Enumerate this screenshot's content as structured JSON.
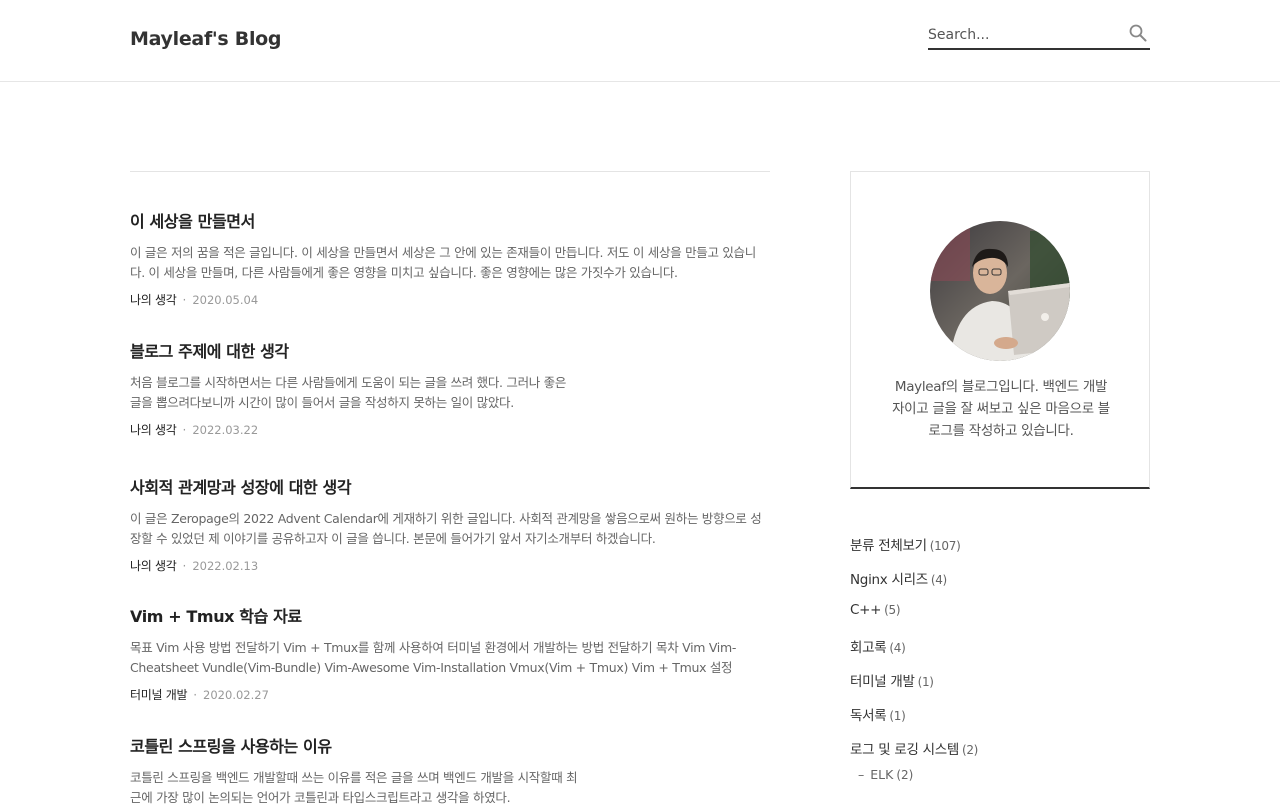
{
  "header": {
    "blog_title": "Mayleaf's Blog",
    "search_placeholder": "Search..."
  },
  "posts": [
    {
      "title": "이 세상을 만들면서",
      "excerpt": "이 글은 저의 꿈을 적은 글입니다. 이 세상을 만들면서 세상은 그 안에 있는 존재들이 만듭니다. 저도 이 세상을 만들고 있습니다. 이 세상을 만들며, 다른 사람들에게 좋은 영향을 미치고 싶습니다. 좋은 영향에는 많은 가짓수가 있습니다.",
      "category": "나의 생각",
      "date": "2020.05.04"
    },
    {
      "title": "블로그 주제에 대한 생각",
      "excerpt": "처음 블로그를 시작하면서는 다른 사람들에게 도움이 되는 글을 쓰려 했다. 그러나 좋은 글을 뽑으려다보니까 시간이 많이 들어서 글을 작성하지 못하는 일이 많았다.",
      "category": "나의 생각",
      "date": "2022.03.22"
    },
    {
      "title": "사회적 관계망과 성장에 대한 생각",
      "excerpt": "이 글은 Zeropage의 2022 Advent Calendar에 게재하기 위한 글입니다. 사회적 관계망을 쌓음으로써 원하는 방향으로 성장할 수 있었던 제 이야기를 공유하고자 이 글을 씁니다. 본문에 들어가기 앞서 자기소개부터 하겠습니다.",
      "category": "나의 생각",
      "date": "2022.02.13"
    },
    {
      "title": "Vim + Tmux 학습 자료",
      "excerpt": "목표 Vim 사용 방법 전달하기 Vim + Tmux를 함께 사용하여 터미널 환경에서 개발하는 방법 전달하기 목차 Vim Vim-Cheatsheet Vundle(Vim-Bundle) Vim-Awesome Vim-Installation Vmux(Vim + Tmux) Vim + Tmux 설정",
      "category": "터미널 개발",
      "date": "2020.02.27"
    },
    {
      "title": "코틀린 스프링을 사용하는 이유",
      "excerpt": "코틀린 스프링을 백엔드 개발할때 쓰는 이유를 적은 글을 쓰며 백엔드 개발을 시작할때 최근에 가장 많이 논의되는 언어가 코틀린과 타입스크립트라고 생각을 하였다.",
      "category": "",
      "date": ""
    }
  ],
  "sidebar": {
    "profile_description": "Mayleaf의 블로그입니다. 백엔드 개발자이고 글을 잘 써보고 싶은 마음으로 블로그를 작성하고 있습니다.",
    "categories": [
      {
        "label": "분류 전체보기",
        "count": "(107)"
      },
      {
        "label": "Nginx 시리즈",
        "count": "(4)"
      },
      {
        "label": "C++",
        "count": "(5)"
      },
      {
        "label": "회고록",
        "count": "(4)"
      },
      {
        "label": "터미널 개발",
        "count": "(1)"
      },
      {
        "label": "독서록",
        "count": "(1)"
      },
      {
        "label": "로그 및 로깅 시스템",
        "count": "(2)"
      }
    ],
    "subcategories": [
      {
        "dash": "–",
        "label": "ELK",
        "count": "(2)"
      }
    ]
  },
  "colors": {
    "accent_border": "#333333",
    "text_muted": "#666666",
    "date_gray": "#999999"
  }
}
